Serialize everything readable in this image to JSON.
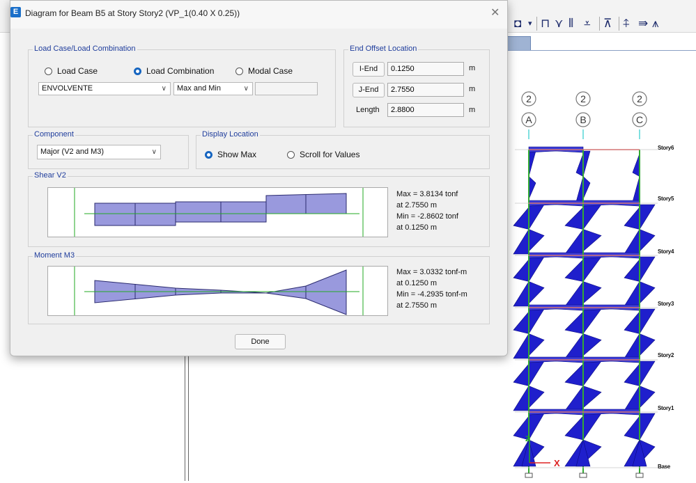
{
  "dialog": {
    "app_icon_letter": "E",
    "title": "Diagram for Beam B5 at Story Story2 (VP_1(0.40 X 0.25))",
    "close_glyph": "✕",
    "load_group": {
      "title": "Load Case/Load Combination",
      "options": [
        "Load Case",
        "Load Combination",
        "Modal Case"
      ],
      "selected": "Load Combination",
      "combo_value": "ENVOLVENTE",
      "envelope_value": "Max and Min",
      "extra_value": ""
    },
    "end_offset": {
      "title": "End Offset Location",
      "i_end_label": "I-End",
      "i_end_value": "0.1250",
      "j_end_label": "J-End",
      "j_end_value": "2.7550",
      "length_label": "Length",
      "length_value": "2.8800",
      "unit": "m"
    },
    "component": {
      "title": "Component",
      "value": "Major (V2 and M3)"
    },
    "display_location": {
      "title": "Display Location",
      "options": [
        "Show Max",
        "Scroll for Values"
      ],
      "selected": "Show Max"
    },
    "shear": {
      "title": "Shear V2",
      "max_text": "Max = 3.8134 tonf",
      "max_at": "at 2.7550 m",
      "min_text": "Min = -2.8602 tonf",
      "min_at": "at 0.1250 m"
    },
    "moment": {
      "title": "Moment M3",
      "max_text": "Max = 3.0332 tonf-m",
      "max_at": "at 0.1250 m",
      "min_text": "Min = -4.2935 tonf-m",
      "min_at": "at 2.7550 m"
    },
    "done_label": "Done"
  },
  "model_view": {
    "grid_top": [
      "2",
      "2",
      "2"
    ],
    "grid_bottom": [
      "A",
      "B",
      "C"
    ],
    "stories": [
      "Story6",
      "Story5",
      "Story4",
      "Story3",
      "Story2",
      "Story1",
      "Base"
    ],
    "axis_z": "Z",
    "axis_x": "X"
  },
  "colors": {
    "diagram_fill": "#9999dd",
    "diagram_stroke": "#1a1a6e",
    "moment_frame_fill": "#1f1fcc",
    "column_green": "#33aa33",
    "beam_red": "#dd2222",
    "accent": "#1665c0"
  },
  "toolbar_icons": [
    "cube-icon",
    "frame-icon",
    "brace-icon",
    "wall-icon",
    "slab-icon",
    "support-icon",
    "load-icon"
  ]
}
